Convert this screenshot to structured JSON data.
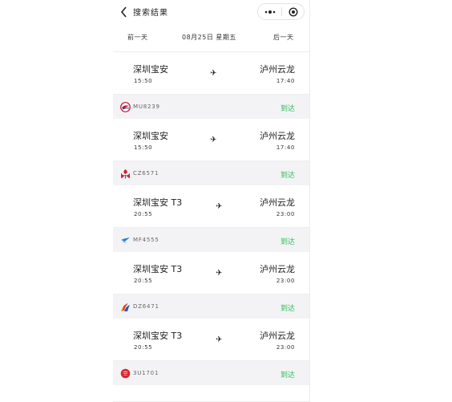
{
  "navbar": {
    "title": "搜索结果",
    "back_icon": "chevron-left-icon",
    "more_icon": "more-dots-icon",
    "close_icon": "target-circle-icon"
  },
  "datebar": {
    "prev": "前一天",
    "date": "08月25日 星期五",
    "next": "后一天"
  },
  "colors": {
    "status_green": "#2dbc59",
    "background": "#f3f3f5"
  },
  "routes": [
    {
      "from": "深圳宝安",
      "dep": "15:50",
      "to": "泸州云龙",
      "arr": "17:40"
    },
    {
      "from": "深圳宝安",
      "dep": "15:50",
      "to": "泸州云龙",
      "arr": "17:40"
    },
    {
      "from": "深圳宝安 T3",
      "dep": "20:55",
      "to": "泸州云龙",
      "arr": "23:00"
    },
    {
      "from": "深圳宝安 T3",
      "dep": "20:55",
      "to": "泸州云龙",
      "arr": "23:00"
    },
    {
      "from": "深圳宝安 T3",
      "dep": "20:55",
      "to": "泸州云龙",
      "arr": "23:00"
    }
  ],
  "flights": [
    {
      "no": "MU8239",
      "status": "到达",
      "logo": "china-eastern-logo"
    },
    {
      "no": "CZ6571",
      "status": "到达",
      "logo": "china-southern-logo"
    },
    {
      "no": "MF4555",
      "status": "到达",
      "logo": "xiamen-airlines-logo"
    },
    {
      "no": "DZ6471",
      "status": "到达",
      "logo": "donghai-airlines-logo"
    },
    {
      "no": "3U1701",
      "status": "到达",
      "logo": "sichuan-airlines-logo"
    }
  ],
  "plane_glyph": "✈"
}
